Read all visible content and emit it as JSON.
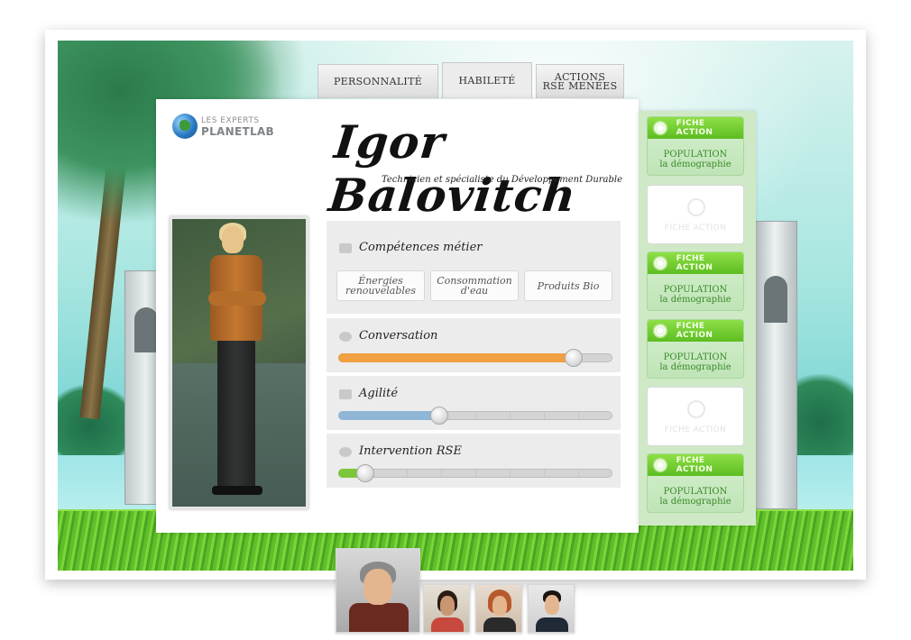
{
  "tabs": [
    {
      "label": "PERSONNALITÉ",
      "active": false
    },
    {
      "label": "HABILETÉ",
      "active": true
    },
    {
      "label": "ACTIONS RSE MENÉES",
      "active": false
    }
  ],
  "logo": {
    "top": "LES EXPERTS",
    "bottom": "PLANETLAB"
  },
  "profile": {
    "name": "Igor Balovitch",
    "subtitle": "Technicien et spécialiste du Développement Durable"
  },
  "skills": {
    "competences": {
      "title": "Compétences métier",
      "chips": [
        "Énergies renouvelables",
        "Consommation d'eau",
        "Produits Bio"
      ]
    },
    "conversation": {
      "title": "Conversation",
      "level": 0.86,
      "color": "#f0a040"
    },
    "agilite": {
      "title": "Agilité",
      "level": 0.37,
      "color": "#8fb6d6"
    },
    "intervention": {
      "title": "Intervention RSE",
      "level": 0.1,
      "color": "#7cc63a"
    }
  },
  "action_cards": [
    {
      "type": "filled",
      "head": "FICHE ACTION",
      "line1": "POPULATION",
      "line2": "la démographie"
    },
    {
      "type": "blank",
      "head": "FICHE ACTION"
    },
    {
      "type": "filled",
      "head": "FICHE ACTION",
      "line1": "POPULATION",
      "line2": "la démographie"
    },
    {
      "type": "filled",
      "head": "FICHE ACTION",
      "line1": "POPULATION",
      "line2": "la démographie"
    },
    {
      "type": "blank",
      "head": "FICHE ACTION"
    },
    {
      "type": "filled",
      "head": "FICHE ACTION",
      "line1": "POPULATION",
      "line2": "la démographie"
    }
  ],
  "thumbnails": [
    {
      "name": "expert-1",
      "selected": true
    },
    {
      "name": "expert-2",
      "selected": false
    },
    {
      "name": "expert-3",
      "selected": false
    },
    {
      "name": "expert-4",
      "selected": false
    }
  ],
  "icons": {
    "logo": "globe-icon",
    "competences": "briefcase-icon",
    "conversation": "speech-bubble-icon",
    "agilite": "pointing-hand-icon",
    "intervention": "magnifier-icon",
    "card": "flower-icon"
  }
}
